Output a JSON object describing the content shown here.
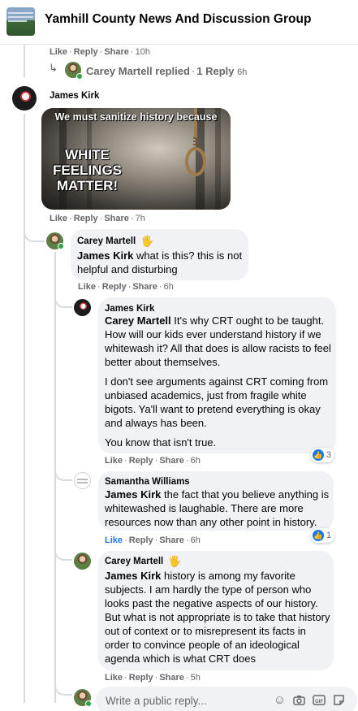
{
  "header": {
    "group_title": "Yamhill County News And Discussion Group"
  },
  "top_comment_meta": {
    "like": "Like",
    "reply": "Reply",
    "share": "Share",
    "time": "10h"
  },
  "collapsed_reply": {
    "text": "Carey Martell replied",
    "count": "1 Reply",
    "time": "6h"
  },
  "james_comment": {
    "author": "James Kirk",
    "meme": {
      "top_text": "We must sanitize history because",
      "big_text_lines": [
        "WHITE",
        "FEELINGS",
        "MATTER!"
      ]
    },
    "meta": {
      "like": "Like",
      "reply": "Reply",
      "share": "Share",
      "time": "7h"
    }
  },
  "replies": [
    {
      "author": "Carey Martell",
      "badge_icon": "glove-icon",
      "tag": "James Kirk",
      "text": " what is this? this is not helpful and disturbing",
      "meta": {
        "like": "Like",
        "reply": "Reply",
        "share": "Share",
        "time": "6h"
      }
    },
    {
      "author": "James Kirk",
      "tag": "Carey Martell",
      "paragraphs": [
        " It's why CRT ought to be taught. How will our kids ever understand history if we whitewash it? All that does is allow racists to feel better about themselves.",
        "I don't see arguments against CRT coming from unbiased academics, just from fragile white bigots. Ya'll want to pretend everything is okay and always has been.",
        "You know that isn't true."
      ],
      "reactions": "3",
      "meta": {
        "like": "Like",
        "reply": "Reply",
        "share": "Share",
        "time": "6h"
      }
    },
    {
      "author": "Samantha Williams",
      "tag": "James Kirk",
      "text": " the fact that you believe anything is whitewashed is laughable. There are more resources now than any other point in history.",
      "reactions": "1",
      "meta": {
        "like": "Like",
        "reply": "Reply",
        "share": "Share",
        "time": "6h"
      }
    },
    {
      "author": "Carey Martell",
      "badge_icon": "glove-icon",
      "tag": "James Kirk",
      "text": " history is among my favorite subjects. I am hardly the type of person who looks past the negative aspects of our history. But what is not appropriate is to take that history out of context or to misrepresent its facts in order to convince people of an ideological agenda which is what CRT does",
      "meta": {
        "like": "Like",
        "reply": "Reply",
        "share": "Share",
        "time": "5h"
      }
    }
  ],
  "reply_input": {
    "placeholder": "Write a public reply...",
    "icons": [
      "emoji-icon",
      "camera-icon",
      "gif-icon",
      "sticker-icon"
    ]
  },
  "colors": {
    "link_blue": "#1877f2",
    "meta_gray": "#65676b",
    "bubble_bg": "#f0f2f5",
    "online_green": "#31a24c"
  }
}
